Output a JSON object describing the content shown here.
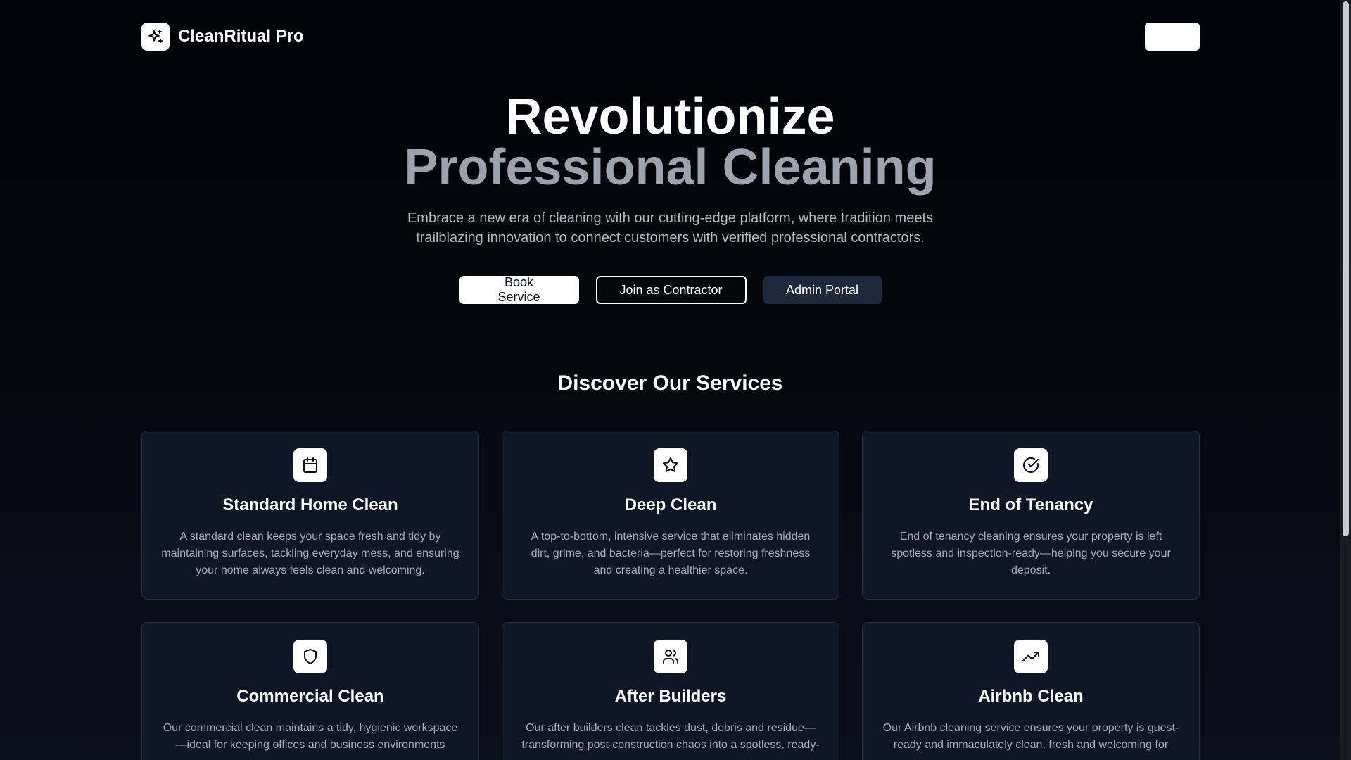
{
  "header": {
    "brand_name": "CleanRitual Pro",
    "logo_icon": "sparkles-icon",
    "button_label": ""
  },
  "hero": {
    "title_line1": "Revolutionize",
    "title_line2": "Professional Cleaning",
    "subtitle": "Embrace a new era of cleaning with our cutting-edge platform, where tradition meets trailblazing innovation to connect customers with verified professional contractors.",
    "actions": {
      "book": "Book Service",
      "join": "Join as Contractor",
      "admin": "Admin Portal"
    }
  },
  "services": {
    "title": "Discover Our Services",
    "items": [
      {
        "icon": "calendar-icon",
        "title": "Standard Home Clean",
        "description": "A standard clean keeps your space fresh and tidy by maintaining surfaces, tackling everyday mess, and ensuring your home always feels clean and welcoming."
      },
      {
        "icon": "star-icon",
        "title": "Deep Clean",
        "description": "A top-to-bottom, intensive service that eliminates hidden dirt, grime, and bacteria—perfect for restoring freshness and creating a healthier space."
      },
      {
        "icon": "check-circle-icon",
        "title": "End of Tenancy",
        "description": "End of tenancy cleaning ensures your property is left spotless and inspection-ready—helping you secure your deposit."
      },
      {
        "icon": "shield-icon",
        "title": "Commercial Clean",
        "description": "Our commercial clean maintains a tidy, hygienic workspace—ideal for keeping offices and business environments"
      },
      {
        "icon": "users-icon",
        "title": "After Builders",
        "description": "Our after builders clean tackles dust, debris and residue—transforming post-construction chaos into a spotless, ready-"
      },
      {
        "icon": "trending-up-icon",
        "title": "Airbnb Clean",
        "description": "Our Airbnb cleaning service ensures your property is guest-ready and immaculately clean, fresh and welcoming for"
      }
    ]
  },
  "colors": {
    "background": "#05070d",
    "card_bg": "#0f1626",
    "card_border": "#253042",
    "muted_text": "#9ca3af",
    "admin_button": "#1e293b"
  }
}
